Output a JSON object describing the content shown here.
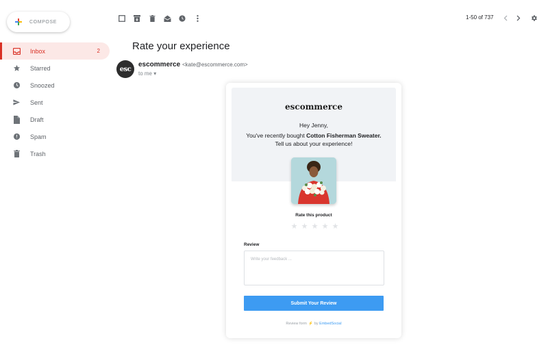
{
  "compose": {
    "label": "COMPOSE",
    "icon": "compose-plus-icon"
  },
  "sidebar": {
    "items": [
      {
        "label": "Inbox",
        "count": "2",
        "icon": "inbox-icon",
        "active": true
      },
      {
        "label": "Starred",
        "icon": "star-icon"
      },
      {
        "label": "Snoozed",
        "icon": "clock-icon"
      },
      {
        "label": "Sent",
        "icon": "send-icon"
      },
      {
        "label": "Draft",
        "icon": "file-icon"
      },
      {
        "label": "Spam",
        "icon": "alert-icon"
      },
      {
        "label": "Trash",
        "icon": "trash-icon"
      }
    ]
  },
  "toolbar": {
    "buttons": [
      "checkbox-icon",
      "archive-icon",
      "delete-icon",
      "mark-read-icon",
      "snooze-icon",
      "more-icon"
    ]
  },
  "pager": {
    "range": "1-50 of 737"
  },
  "message": {
    "subject": "Rate your experience",
    "sender_avatar": "esc",
    "sender_name": "escommerce",
    "sender_email": "<kate@escommerce.com>",
    "to": "to me"
  },
  "email": {
    "brand": "escommerce",
    "greeting": "Hey Jenny,",
    "line_prefix": "You've recently bought ",
    "product": "Cotton Fisherman Sweater.",
    "line_suffix": "Tell us about your experience!",
    "rate_label": "Rate this product",
    "rating_stars": 5,
    "rating_value": 0,
    "review_label": "Review",
    "review_placeholder": "Write your feedback ...",
    "review_value": "",
    "submit_label": "Submit Your Review",
    "footer_prefix": "Review form",
    "footer_by": "by",
    "footer_link": "EmbedSocial"
  },
  "colors": {
    "accent": "#d93025",
    "active_bg": "#fce8e6",
    "banner_bg": "#f1f3f6",
    "submit_bg": "#3d9bf2",
    "star_empty": "#e1e3e6"
  }
}
